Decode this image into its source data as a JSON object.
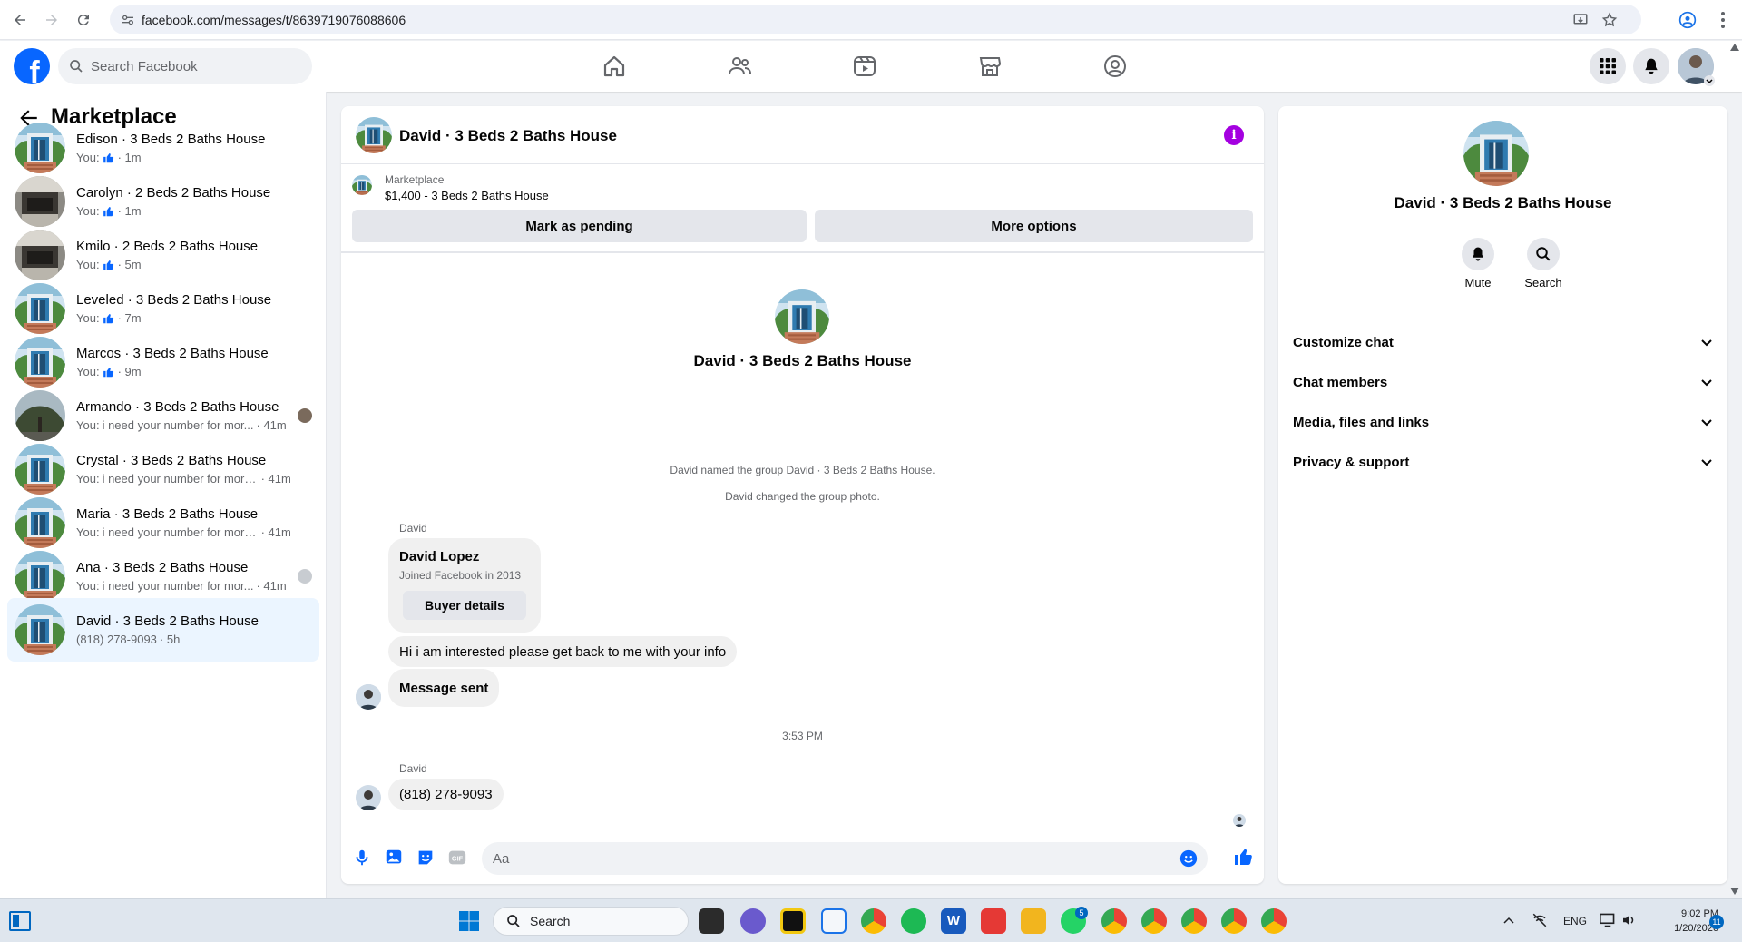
{
  "browser": {
    "url": "facebook.com/messages/t/8639719076088606"
  },
  "header": {
    "search_placeholder": "Search Facebook"
  },
  "sidebar": {
    "title": "Marketplace",
    "conversations": [
      {
        "name": "Edison · 3 Beds 2 Baths House",
        "prefix": "You:",
        "preview": "",
        "thumb_up": true,
        "time": "· 1m",
        "active": false
      },
      {
        "name": "Carolyn · 2 Beds 2 Baths House",
        "prefix": "You:",
        "preview": "",
        "thumb_up": true,
        "time": "· 1m",
        "active": false
      },
      {
        "name": "Kmilo · 2 Beds 2 Baths House",
        "prefix": "You:",
        "preview": "",
        "thumb_up": true,
        "time": "· 5m",
        "active": false
      },
      {
        "name": "Leveled · 3 Beds 2 Baths House",
        "prefix": "You:",
        "preview": "",
        "thumb_up": true,
        "time": "· 7m",
        "active": false
      },
      {
        "name": "Marcos · 3 Beds 2 Baths House",
        "prefix": "You:",
        "preview": "",
        "thumb_up": true,
        "time": "· 9m",
        "active": false
      },
      {
        "name": "Armando · 3 Beds 2 Baths House",
        "prefix": "You:",
        "preview": "i need your number for mor...",
        "thumb_up": false,
        "time": "· 41m",
        "active": false
      },
      {
        "name": "Crystal · 3 Beds 2 Baths House",
        "prefix": "You:",
        "preview": "i need your number for more in...",
        "thumb_up": false,
        "time": "· 41m",
        "active": false
      },
      {
        "name": "Maria · 3 Beds 2 Baths House",
        "prefix": "You:",
        "preview": "i need your number for more in...",
        "thumb_up": false,
        "time": "· 41m",
        "active": false
      },
      {
        "name": "Ana · 3 Beds 2 Baths House",
        "prefix": "You:",
        "preview": "i need your number for mor...",
        "thumb_up": false,
        "time": "· 41m",
        "active": false
      },
      {
        "name": "David · 3 Beds 2 Baths House",
        "prefix": "",
        "preview": "(818) 278-9093",
        "thumb_up": false,
        "time": "· 5h",
        "active": true
      }
    ]
  },
  "chat": {
    "title": "David · 3 Beds 2 Baths House",
    "listing": {
      "label": "Marketplace",
      "price_title": "$1,400 - 3 Beds 2 Baths House"
    },
    "mark_pending_label": "Mark as pending",
    "more_options_label": "More options",
    "intro_name": "David · 3 Beds 2 Baths House",
    "system_msgs": [
      "David named the group David · 3 Beds 2 Baths House.",
      "David changed the group photo."
    ],
    "sender1": "David",
    "buyer": {
      "name": "David Lopez",
      "joined": "Joined Facebook in 2013",
      "button": "Buyer details"
    },
    "msg_interest": "Hi i am interested please get back to me with your info",
    "msg_sent": "Message sent",
    "timestamp": "3:53 PM",
    "sender2": "David",
    "msg_phone": "(818) 278-9093",
    "composer_placeholder": "Aa"
  },
  "details": {
    "name": "David · 3 Beds 2 Baths House",
    "mute_label": "Mute",
    "search_label": "Search",
    "sections": [
      "Customize chat",
      "Chat members",
      "Media, files and links",
      "Privacy & support"
    ]
  },
  "taskbar": {
    "search_label": "Search",
    "lang": "ENG",
    "time": "9:02 PM",
    "date": "1/20/2026",
    "whatsapp_badge": "5",
    "notif_badge": "11"
  },
  "colors": {
    "fb_blue": "#0866ff",
    "info_purple": "#a400e0",
    "active_row": "#ebf5ff"
  }
}
